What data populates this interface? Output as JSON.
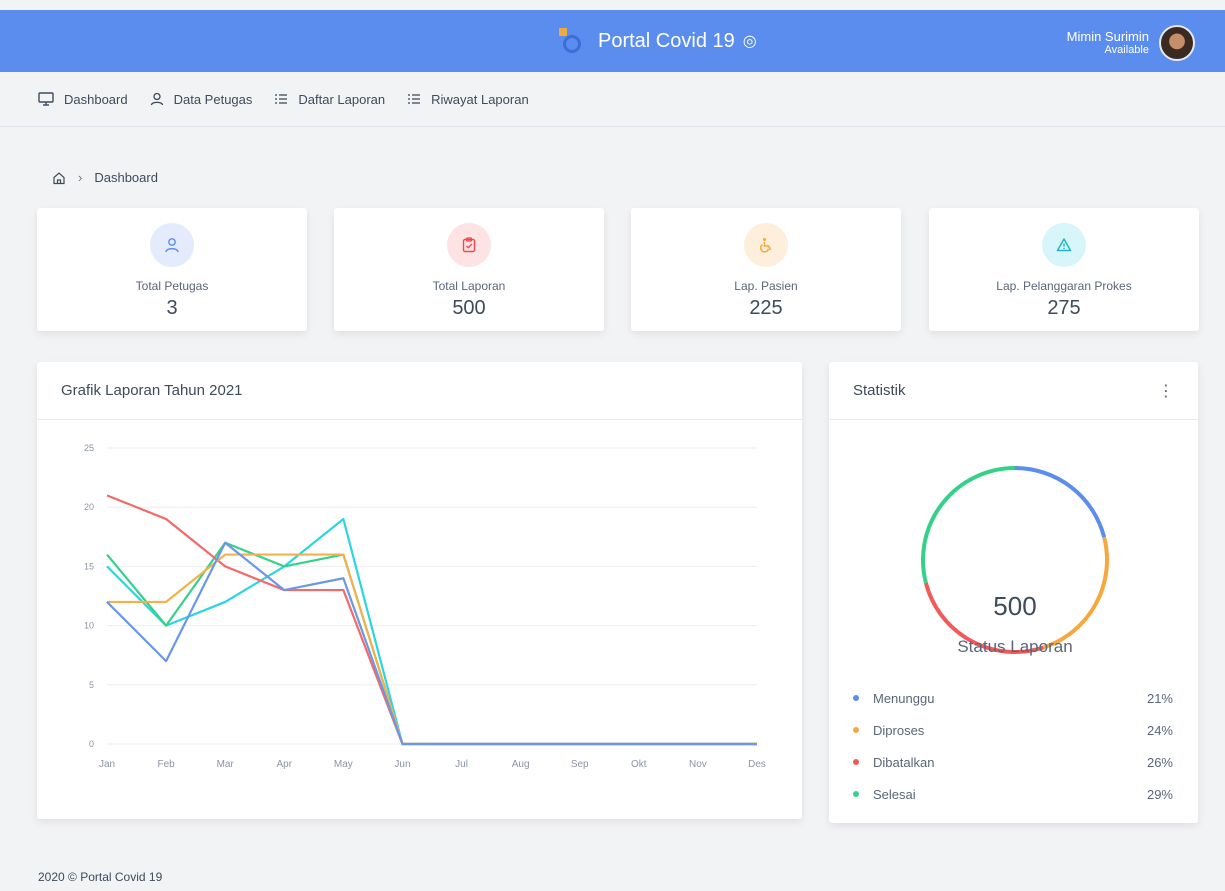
{
  "app": {
    "title": "Portal Covid 19",
    "title_icon": "target-icon"
  },
  "user": {
    "name": "Mimin Surimin",
    "status": "Available"
  },
  "nav": {
    "items": [
      {
        "label": "Dashboard",
        "icon": "monitor-icon"
      },
      {
        "label": "Data Petugas",
        "icon": "user-icon"
      },
      {
        "label": "Daftar Laporan",
        "icon": "list-icon"
      },
      {
        "label": "Riwayat Laporan",
        "icon": "list-icon"
      }
    ]
  },
  "breadcrumb": {
    "current": "Dashboard"
  },
  "stats": [
    {
      "label": "Total Petugas",
      "value": "3",
      "icon": "user-icon",
      "color": "#5b8def",
      "bg": "#e3ebfd"
    },
    {
      "label": "Total Laporan",
      "value": "500",
      "icon": "clipboard-check-icon",
      "color": "#f0484e",
      "bg": "#fde3e4"
    },
    {
      "label": "Lap. Pasien",
      "value": "225",
      "icon": "wheelchair-icon",
      "color": "#f2a93b",
      "bg": "#fdefdc"
    },
    {
      "label": "Lap. Pelanggaran Prokes",
      "value": "275",
      "icon": "warning-icon",
      "color": "#1fb6c9",
      "bg": "#d8f6fa"
    }
  ],
  "chart_panel": {
    "title": "Grafik Laporan Tahun 2021"
  },
  "chart_data": {
    "type": "line",
    "title": "Grafik Laporan Tahun 2021",
    "categories": [
      "Jan",
      "Feb",
      "Mar",
      "Apr",
      "May",
      "Jun",
      "Jul",
      "Aug",
      "Sep",
      "Okt",
      "Nov",
      "Des"
    ],
    "ylim": [
      0,
      25
    ],
    "yticks": [
      0,
      5,
      10,
      15,
      20,
      25
    ],
    "grid": true,
    "series": [
      {
        "color": "#6c97e6",
        "values": [
          12,
          7,
          17,
          13,
          14,
          0,
          0,
          0,
          0,
          0,
          0,
          0
        ]
      },
      {
        "color": "#f5b04b",
        "values": [
          12,
          12,
          16,
          16,
          16,
          0,
          0,
          0,
          0,
          0,
          0,
          0
        ]
      },
      {
        "color": "#f26a6a",
        "values": [
          21,
          19,
          15,
          13,
          13,
          0,
          0,
          0,
          0,
          0,
          0,
          0
        ]
      },
      {
        "color": "#35d18a",
        "values": [
          16,
          10,
          17,
          15,
          16,
          0,
          0,
          0,
          0,
          0,
          0,
          0
        ]
      },
      {
        "color": "#2cd6e0",
        "values": [
          15,
          10,
          12,
          15,
          19,
          0,
          0,
          0,
          0,
          0,
          0,
          0
        ]
      }
    ]
  },
  "stat_panel": {
    "title": "Statistik"
  },
  "donut": {
    "total": "500",
    "label": "Status Laporan",
    "items": [
      {
        "label": "Menunggu",
        "pct": "21%",
        "value": 21,
        "color": "#5b8def"
      },
      {
        "label": "Diproses",
        "pct": "24%",
        "value": 24,
        "color": "#f5a83f"
      },
      {
        "label": "Dibatalkan",
        "pct": "26%",
        "value": 26,
        "color": "#f25a5a"
      },
      {
        "label": "Selesai",
        "pct": "29%",
        "value": 29,
        "color": "#35d18a"
      }
    ]
  },
  "footer": {
    "text": "2020 © Portal Covid 19"
  }
}
